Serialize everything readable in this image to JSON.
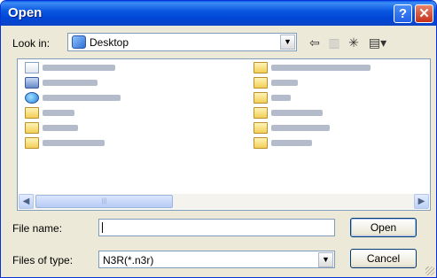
{
  "window": {
    "title": "Open"
  },
  "title_buttons": {
    "help": "?",
    "close": "✕"
  },
  "look_in": {
    "label": "Look in:",
    "value": "Desktop",
    "dropdown_arrow": "▼"
  },
  "toolbar": {
    "back": "⇦",
    "up": "▥",
    "new_folder": "✳",
    "views": "▤▾"
  },
  "file_list": {
    "items": [
      {
        "icon": "my-documents-icon"
      },
      {
        "icon": "my-computer-icon"
      },
      {
        "icon": "my-network-places-icon"
      },
      {
        "icon": "folder-icon"
      },
      {
        "icon": "folder-icon"
      },
      {
        "icon": "folder-icon"
      },
      {
        "icon": "folder-icon"
      },
      {
        "icon": "folder-icon"
      },
      {
        "icon": "folder-icon"
      },
      {
        "icon": "folder-icon"
      },
      {
        "icon": "folder-icon"
      },
      {
        "icon": "folder-icon"
      }
    ],
    "scroll_left": "◀",
    "scroll_right": "▶",
    "thumb_grip": "|||"
  },
  "file_name": {
    "label": "File name:",
    "value": ""
  },
  "file_type": {
    "label": "Files of type:",
    "value": "N3R(*.n3r)",
    "dropdown_arrow": "▼"
  },
  "buttons": {
    "open": "Open",
    "cancel": "Cancel"
  }
}
